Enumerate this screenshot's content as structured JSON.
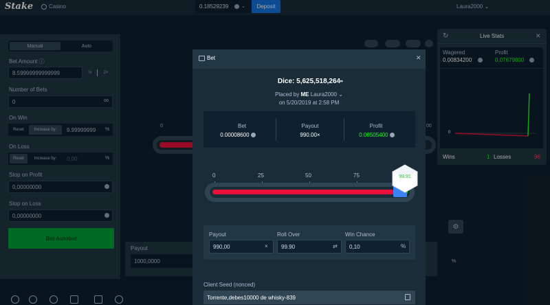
{
  "topbar": {
    "logo": "Stake",
    "casino": "Casino",
    "balance": "0.18529239",
    "deposit": "Deposit",
    "user": "Laura2000"
  },
  "left": {
    "modes": [
      "Manual",
      "Auto"
    ],
    "bet_amount_label": "Bet Amount",
    "bet_amount_value": "8.59999999999999",
    "half": "½",
    "double": "2×",
    "num_bets_label": "Number of Bets",
    "num_bets_value": "0",
    "infinity": "∞",
    "on_win_label": "On Win",
    "on_win_reset": "Reset",
    "on_win_increase": "Increase by:",
    "on_win_value": "9.99999999",
    "pct": "%",
    "on_loss_label": "On Loss",
    "on_loss_reset": "Reset",
    "on_loss_increase": "Increase by:",
    "on_loss_value": "0,00",
    "stop_profit_label": "Stop on Profit",
    "stop_profit_value": "0,00000000",
    "stop_loss_label": "Stop on Loss",
    "stop_loss_value": "0,00000000",
    "bet_button": "Bet Autobet"
  },
  "game": {
    "bg_zero": "0",
    "bg_hundred": "00",
    "payout_label": "Payout",
    "payout_value": "1000,0000",
    "pct": "%"
  },
  "live_stats": {
    "title": "Live Stats",
    "wagered_label": "Wagered",
    "wagered_value": "0.00834200",
    "profit_label": "Profit",
    "profit_value": "0.07679800",
    "graph_zero": "0",
    "wins_label": "Wins",
    "wins_value": "1",
    "losses_label": "Losses",
    "losses_value": "96"
  },
  "modal": {
    "title": "Bet",
    "dice_title": "Dice: 5,625,518,264",
    "placed_by": "Placed by",
    "placed_by_me": "ME",
    "placed_user": "Laura2000",
    "date": "on 5/20/2019 at 2:58 PM",
    "bet_label": "Bet",
    "bet_value": "0.00008600",
    "payout_label": "Payout",
    "payout_value": "990.00×",
    "profit_label": "Profit",
    "profit_value": "0.08505400",
    "slider_labels": [
      "0",
      "25",
      "50",
      "75",
      "100"
    ],
    "result": "99.91",
    "roll_over_fraction": 0.999,
    "input_payout_label": "Payout",
    "input_payout_value": "990,00",
    "input_roll_label": "Roll Over",
    "input_roll_value": "99.90",
    "input_chance_label": "Win Chance",
    "input_chance_value": "0,10",
    "times": "×",
    "swap": "⇄",
    "pct": "%",
    "seed_label": "Client Seed (nonced)",
    "seed_value": "Torrente,debes10000 de whisky-839"
  },
  "colors": {
    "bg": "#0f212e",
    "panel": "#213743",
    "accent": "#1475e1",
    "win": "#1fff20",
    "loss": "#e9113c"
  }
}
